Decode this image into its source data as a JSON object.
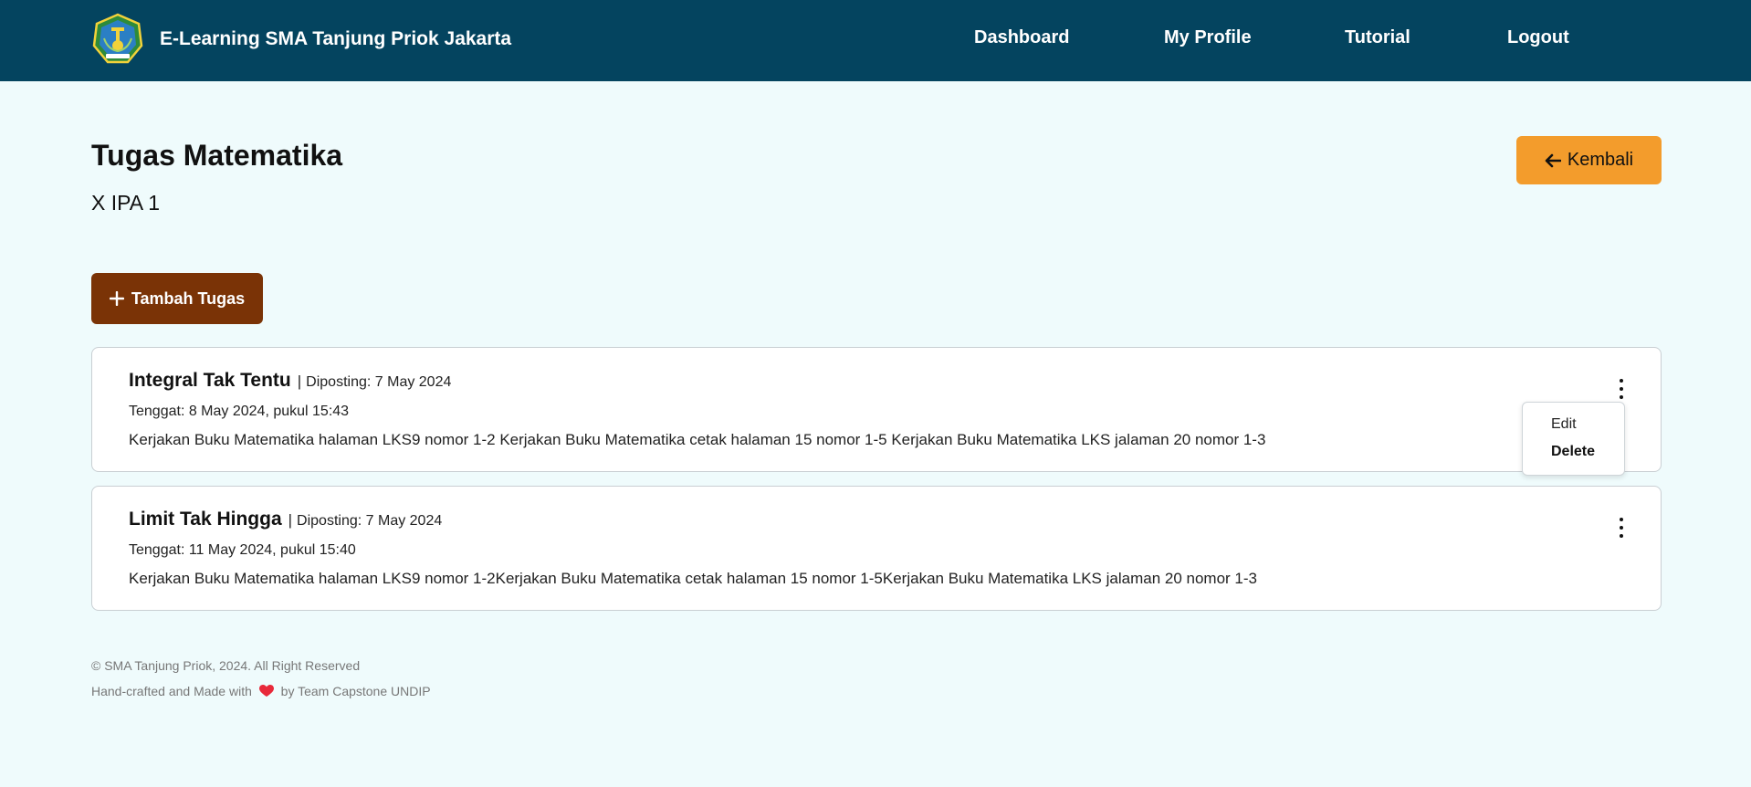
{
  "header": {
    "brand_title": "E-Learning SMA Tanjung Priok Jakarta",
    "nav": [
      {
        "label": "Dashboard"
      },
      {
        "label": "My Profile"
      },
      {
        "label": "Tutorial"
      },
      {
        "label": "Logout"
      }
    ]
  },
  "page": {
    "title": "Tugas Matematika",
    "subtitle": "X IPA 1",
    "back_label": "Kembali",
    "add_label": "Tambah Tugas"
  },
  "tasks": [
    {
      "title": "Integral Tak Tentu",
      "separator": "|",
      "posted": "Diposting: 7 May 2024",
      "deadline": "Tenggat: 8 May 2024, pukul 15:43",
      "description": "Kerjakan Buku Matematika halaman LKS9 nomor 1-2 Kerjakan Buku Matematika cetak halaman 15 nomor 1-5 Kerjakan Buku Matematika LKS jalaman 20 nomor 1-3"
    },
    {
      "title": "Limit Tak Hingga",
      "separator": "|",
      "posted": "Diposting: 7 May 2024",
      "deadline": "Tenggat: 11 May 2024, pukul 15:40",
      "description": "Kerjakan Buku Matematika halaman LKS9 nomor 1-2Kerjakan Buku Matematika cetak halaman 15 nomor 1-5Kerjakan Buku Matematika LKS jalaman 20 nomor 1-3"
    }
  ],
  "dropdown": {
    "edit_label": "Edit",
    "delete_label": "Delete"
  },
  "footer": {
    "copyright": "© SMA Tanjung Priok, 2024. All Right Reserved",
    "made_prefix": "Hand-crafted and Made with",
    "made_suffix": "by Team Capstone UNDIP"
  },
  "colors": {
    "navbar": "#04445f",
    "background": "#effbfc",
    "back_button": "#f39c2c",
    "add_button": "#7a3306",
    "heart": "#e8293a"
  },
  "icons": {
    "logo": "school-logo-icon",
    "back": "arrow-left-icon",
    "add": "plus-icon",
    "menu": "kebab-menu-icon",
    "heart": "heart-icon"
  }
}
